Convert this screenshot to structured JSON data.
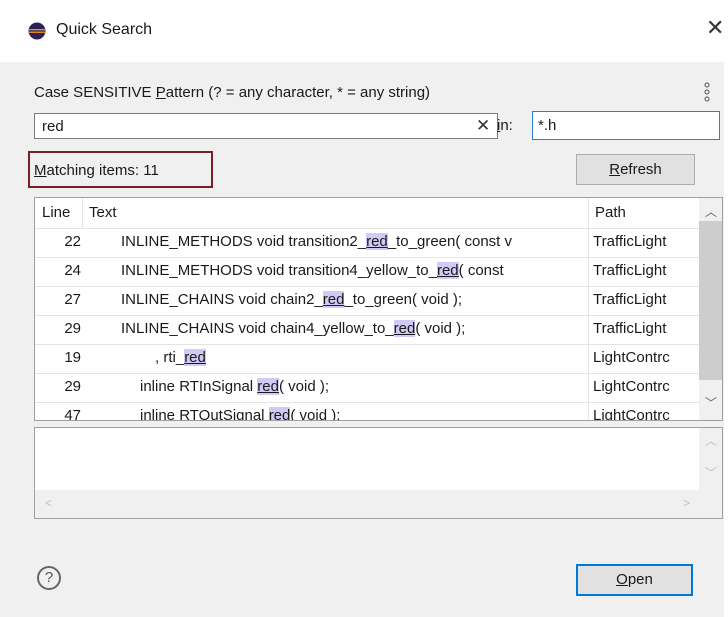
{
  "window": {
    "title": "Quick Search"
  },
  "search": {
    "caption_before": "Case SENSITIVE ",
    "caption_mnemonic": "P",
    "caption_after": "attern (? = any character, * = any string)",
    "pattern": "red",
    "in_mnemonic": "i",
    "in_after": "n:",
    "filter": "*.h"
  },
  "results": {
    "matching_mnemonic": "M",
    "matching_after": "atching items: 11",
    "refresh_mnemonic": "R",
    "refresh_after": "efresh",
    "columns": {
      "line": "Line",
      "text": "Text",
      "path": "Path"
    },
    "rows": [
      {
        "line": "22",
        "indent": 0,
        "before": "INLINE_METHODS void transition2_",
        "match": "red",
        "after": "_to_green( const v",
        "path": "TrafficLight"
      },
      {
        "line": "24",
        "indent": 0,
        "before": "INLINE_METHODS void transition4_yellow_to_",
        "match": "red",
        "after": "( const",
        "path": "TrafficLight"
      },
      {
        "line": "27",
        "indent": 0,
        "before": "INLINE_CHAINS void chain2_",
        "match": "red",
        "after": "_to_green( void );",
        "path": "TrafficLight"
      },
      {
        "line": "29",
        "indent": 0,
        "before": "INLINE_CHAINS void chain4_yellow_to_",
        "match": "red",
        "after": "( void );",
        "path": "TrafficLight"
      },
      {
        "line": "19",
        "indent": 2,
        "before": ", rti_",
        "match": "red",
        "after": "",
        "path": "LightContrc"
      },
      {
        "line": "29",
        "indent": 1,
        "before": "inline RTInSignal ",
        "match": "red",
        "after": "( void );",
        "path": "LightContrc"
      },
      {
        "line": "47",
        "indent": 1,
        "before": "inline RTOutSignal ",
        "match": "red",
        "after": "( void );",
        "path": "LightContrc"
      }
    ]
  },
  "footer": {
    "help": "?",
    "open_mnemonic": "O",
    "open_after": "pen"
  }
}
